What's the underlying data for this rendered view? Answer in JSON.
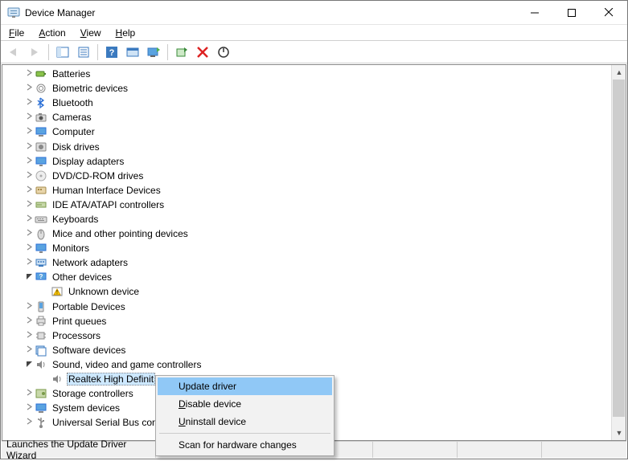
{
  "title": "Device Manager",
  "menus": {
    "file": "File",
    "action": "Action",
    "view": "View",
    "help": "Help"
  },
  "categories": [
    {
      "name": "Batteries",
      "icon": "battery",
      "expanded": false
    },
    {
      "name": "Biometric devices",
      "icon": "biometric",
      "expanded": false
    },
    {
      "name": "Bluetooth",
      "icon": "bluetooth",
      "expanded": false
    },
    {
      "name": "Cameras",
      "icon": "camera",
      "expanded": false
    },
    {
      "name": "Computer",
      "icon": "computer",
      "expanded": false
    },
    {
      "name": "Disk drives",
      "icon": "disk",
      "expanded": false
    },
    {
      "name": "Display adapters",
      "icon": "display",
      "expanded": false
    },
    {
      "name": "DVD/CD-ROM drives",
      "icon": "disc",
      "expanded": false
    },
    {
      "name": "Human Interface Devices",
      "icon": "hid",
      "expanded": false
    },
    {
      "name": "IDE ATA/ATAPI controllers",
      "icon": "ide",
      "expanded": false
    },
    {
      "name": "Keyboards",
      "icon": "keyboard",
      "expanded": false
    },
    {
      "name": "Mice and other pointing devices",
      "icon": "mouse",
      "expanded": false
    },
    {
      "name": "Monitors",
      "icon": "monitor",
      "expanded": false
    },
    {
      "name": "Network adapters",
      "icon": "network",
      "expanded": false
    },
    {
      "name": "Other devices",
      "icon": "other",
      "expanded": true,
      "children": [
        {
          "name": "Unknown device",
          "icon": "warn"
        }
      ]
    },
    {
      "name": "Portable Devices",
      "icon": "portable",
      "expanded": false
    },
    {
      "name": "Print queues",
      "icon": "printer",
      "expanded": false
    },
    {
      "name": "Processors",
      "icon": "cpu",
      "expanded": false
    },
    {
      "name": "Software devices",
      "icon": "software",
      "expanded": false
    },
    {
      "name": "Sound, video and game controllers",
      "icon": "sound",
      "expanded": true,
      "children": [
        {
          "name": "Realtek High Definition Audio",
          "icon": "sound",
          "selected": true,
          "truncated": "Realtek High Definit"
        }
      ]
    },
    {
      "name": "Storage controllers",
      "icon": "storage",
      "expanded": false
    },
    {
      "name": "System devices",
      "icon": "system",
      "expanded": false
    },
    {
      "name": "Universal Serial Bus controllers",
      "icon": "usb",
      "expanded": false
    }
  ],
  "contextmenu": {
    "update": "Update driver",
    "disable": "Disable device",
    "uninstall": "Uninstall device",
    "scan": "Scan for hardware changes"
  },
  "status": "Launches the Update Driver Wizard for the selected device."
}
